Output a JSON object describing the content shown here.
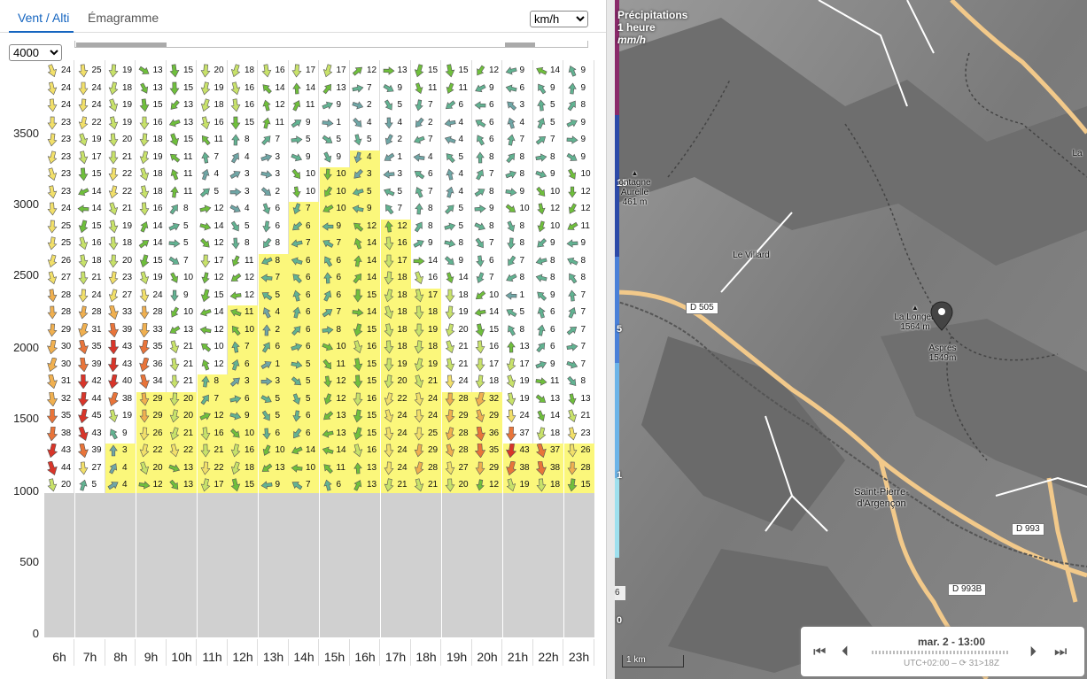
{
  "tabs": {
    "wind_alt": "Vent / Alti",
    "emagramme": "Émagramme"
  },
  "unit_select": {
    "value": "km/h"
  },
  "alt_select": {
    "value": "4000"
  },
  "y_axis": {
    "labels": [
      "3500",
      "3000",
      "2500",
      "2000",
      "1500",
      "1000",
      "500",
      "0"
    ]
  },
  "hours": [
    "6h",
    "7h",
    "8h",
    "9h",
    "10h",
    "11h",
    "12h",
    "13h",
    "14h",
    "15h",
    "16h",
    "17h",
    "18h",
    "19h",
    "20h",
    "21h",
    "22h",
    "23h"
  ],
  "wind_speeds": [
    [
      "24",
      "25",
      "19",
      "13",
      "15",
      "20",
      "18",
      "16",
      "17",
      "17",
      "12",
      "13",
      "15",
      "15",
      "12",
      "9",
      "14",
      "9"
    ],
    [
      "24",
      "24",
      "18",
      "13",
      "15",
      "19",
      "16",
      "14",
      "14",
      "13",
      "7",
      "9",
      "11",
      "11",
      "9",
      "6",
      "9",
      "9"
    ],
    [
      "24",
      "24",
      "19",
      "15",
      "13",
      "18",
      "16",
      "12",
      "11",
      "9",
      "2",
      "5",
      "7",
      "6",
      "6",
      "3",
      "5",
      "8"
    ],
    [
      "23",
      "22",
      "19",
      "16",
      "13",
      "16",
      "15",
      "11",
      "9",
      "1",
      "4",
      "4",
      "2",
      "4",
      "6",
      "4",
      "5",
      "9"
    ],
    [
      "23",
      "19",
      "20",
      "18",
      "15",
      "11",
      "8",
      "7",
      "5",
      "5",
      "5",
      "2",
      "7",
      "4",
      "6",
      "7",
      "7",
      "9"
    ],
    [
      "23",
      "17",
      "21",
      "19",
      "11",
      "7",
      "4",
      "3",
      "9",
      "9",
      "4",
      "1",
      "4",
      "5",
      "8",
      "8",
      "8",
      "9"
    ],
    [
      "23",
      "15",
      "22",
      "18",
      "11",
      "4",
      "3",
      "3",
      "10",
      "10",
      "3",
      "3",
      "6",
      "4",
      "7",
      "8",
      "9",
      "10"
    ],
    [
      "23",
      "14",
      "22",
      "18",
      "11",
      "5",
      "3",
      "2",
      "10",
      "10",
      "5",
      "5",
      "7",
      "4",
      "8",
      "9",
      "10",
      "12"
    ],
    [
      "24",
      "14",
      "21",
      "16",
      "8",
      "12",
      "4",
      "6",
      "7",
      "10",
      "9",
      "7",
      "8",
      "5",
      "9",
      "10",
      "12",
      "12"
    ],
    [
      "25",
      "15",
      "19",
      "14",
      "5",
      "14",
      "5",
      "6",
      "6",
      "9",
      "12",
      "12",
      "8",
      "5",
      "8",
      "8",
      "10",
      "11"
    ],
    [
      "25",
      "16",
      "18",
      "14",
      "5",
      "12",
      "8",
      "8",
      "7",
      "7",
      "14",
      "16",
      "9",
      "8",
      "7",
      "8",
      "9",
      "9"
    ],
    [
      "26",
      "18",
      "20",
      "15",
      "7",
      "17",
      "11",
      "8",
      "6",
      "6",
      "14",
      "17",
      "14",
      "9",
      "6",
      "7",
      "8",
      "8"
    ],
    [
      "27",
      "21",
      "23",
      "19",
      "10",
      "12",
      "12",
      "7",
      "6",
      "6",
      "14",
      "18",
      "16",
      "14",
      "7",
      "8",
      "8",
      "8"
    ],
    [
      "28",
      "24",
      "27",
      "24",
      "9",
      "15",
      "12",
      "5",
      "6",
      "6",
      "15",
      "18",
      "17",
      "18",
      "10",
      "1",
      "9",
      "7"
    ],
    [
      "28",
      "28",
      "33",
      "28",
      "10",
      "14",
      "11",
      "4",
      "6",
      "7",
      "14",
      "18",
      "18",
      "19",
      "14",
      "5",
      "6",
      "7"
    ],
    [
      "29",
      "31",
      "39",
      "33",
      "13",
      "12",
      "10",
      "2",
      "6",
      "8",
      "15",
      "18",
      "19",
      "20",
      "15",
      "8",
      "6",
      "7"
    ],
    [
      "30",
      "35",
      "43",
      "35",
      "21",
      "10",
      "7",
      "6",
      "6",
      "10",
      "16",
      "18",
      "18",
      "21",
      "16",
      "13",
      "6",
      "7"
    ],
    [
      "30",
      "39",
      "43",
      "36",
      "21",
      "12",
      "6",
      "1",
      "5",
      "11",
      "15",
      "19",
      "19",
      "21",
      "17",
      "17",
      "9",
      "7"
    ],
    [
      "31",
      "42",
      "40",
      "34",
      "21",
      "8",
      "3",
      "3",
      "5",
      "12",
      "15",
      "20",
      "21",
      "24",
      "18",
      "19",
      "11",
      "8"
    ],
    [
      "32",
      "44",
      "38",
      "29",
      "20",
      "7",
      "6",
      "5",
      "5",
      "12",
      "16",
      "22",
      "24",
      "28",
      "32",
      "19",
      "13",
      "13"
    ],
    [
      "35",
      "45",
      "19",
      "29",
      "20",
      "12",
      "9",
      "5",
      "6",
      "13",
      "15",
      "24",
      "24",
      "29",
      "29",
      "24",
      "14",
      "21"
    ],
    [
      "38",
      "43",
      "9",
      "26",
      "21",
      "16",
      "10",
      "6",
      "6",
      "13",
      "15",
      "24",
      "25",
      "28",
      "36",
      "37",
      "18",
      "23"
    ],
    [
      "43",
      "39",
      "3",
      "22",
      "22",
      "21",
      "16",
      "10",
      "14",
      "14",
      "16",
      "24",
      "29",
      "28",
      "35",
      "43",
      "37",
      "26"
    ],
    [
      "44",
      "27",
      "4",
      "20",
      "13",
      "22",
      "18",
      "13",
      "10",
      "11",
      "13",
      "24",
      "28",
      "27",
      "29",
      "38",
      "38",
      "28"
    ],
    [
      "20",
      "5",
      "4",
      "12",
      "13",
      "17",
      "15",
      "9",
      "7",
      "6",
      "13",
      "21",
      "21",
      "20",
      "12",
      "19",
      "18",
      "15"
    ]
  ],
  "map": {
    "legend_title": "Précipitations",
    "legend_sub1": "1 heure",
    "legend_unit": "mm/h",
    "legend_ticks": [
      "15",
      "5",
      "1",
      "0"
    ],
    "places": {
      "lapiagne": "ontagne",
      "aurelle": "Aurelle",
      "aurelle_alt": "461 m",
      "villard": "Le Villard",
      "longeagne": "La Longea",
      "longeagne_alt": "1564 m",
      "aspres": "Aspres",
      "aspres_alt": "1549m",
      "saint_pierre": "Saint-Pierre-",
      "argencon": "d'Argençon",
      "la": "La"
    },
    "roads": {
      "d505": "D 505",
      "d993": "D 993",
      "d993b": "D 993B"
    },
    "scale": "1 km",
    "left_six": "6",
    "time": {
      "date": "mar. 2 - 13:00",
      "tz": "UTC+02:00 – ⟳ 31>18Z"
    }
  }
}
